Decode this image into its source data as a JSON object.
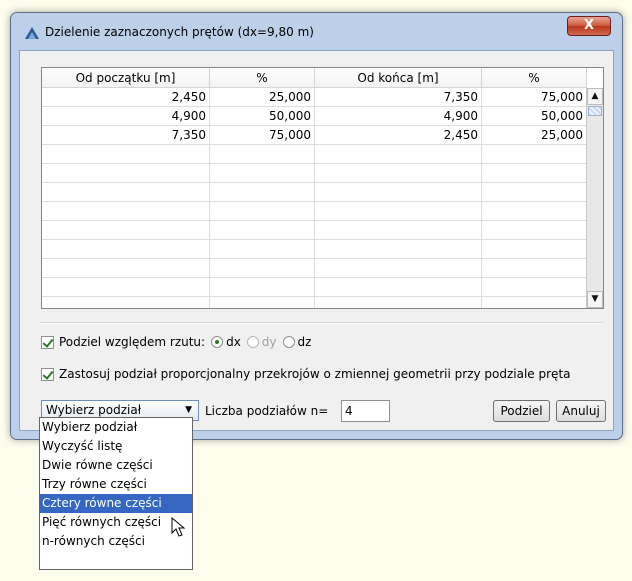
{
  "window": {
    "title": "Dzielenie zaznaczonych prętów (dx=9,80 m)",
    "close_label": "X",
    "icon": "app-icon"
  },
  "table": {
    "headers": [
      "Od początku [m]",
      "%",
      "Od końca [m]",
      "%"
    ],
    "rows": [
      [
        "2,450",
        "25,000",
        "7,350",
        "75,000"
      ],
      [
        "4,900",
        "50,000",
        "4,900",
        "50,000"
      ],
      [
        "7,350",
        "75,000",
        "2,450",
        "25,000"
      ]
    ],
    "scroll_up": "▲",
    "scroll_down": "▼"
  },
  "options": {
    "podziel_label": "Podziel względem rzutu:",
    "podziel_checked": true,
    "radios": [
      {
        "label": "dx",
        "selected": true,
        "enabled": true
      },
      {
        "label": "dy",
        "selected": false,
        "enabled": false
      },
      {
        "label": "dz",
        "selected": false,
        "enabled": true
      }
    ],
    "proporcjonalny_label": "Zastosuj podział proporcjonalny przekrojów o zmiennej geometrii przy podziale pręta",
    "proporcjonalny_checked": true
  },
  "bottom": {
    "select_value": "Wybierz podział",
    "select_arrow": "▼",
    "n_label": "Liczba podziałów n=",
    "n_value": "4",
    "podziel_button": "Podziel",
    "anuluj_button": "Anuluj"
  },
  "dropdown": {
    "items": [
      "Wybierz podział",
      "Wyczyść listę",
      "Dwie równe części",
      "Trzy równe części",
      "Cztery równe części",
      "Pięć równych części",
      "n-równych części"
    ],
    "selected_index": 4
  },
  "colors": {
    "accent": "#3466c2",
    "frame": "#bcd1e9",
    "close": "#c8452b"
  }
}
